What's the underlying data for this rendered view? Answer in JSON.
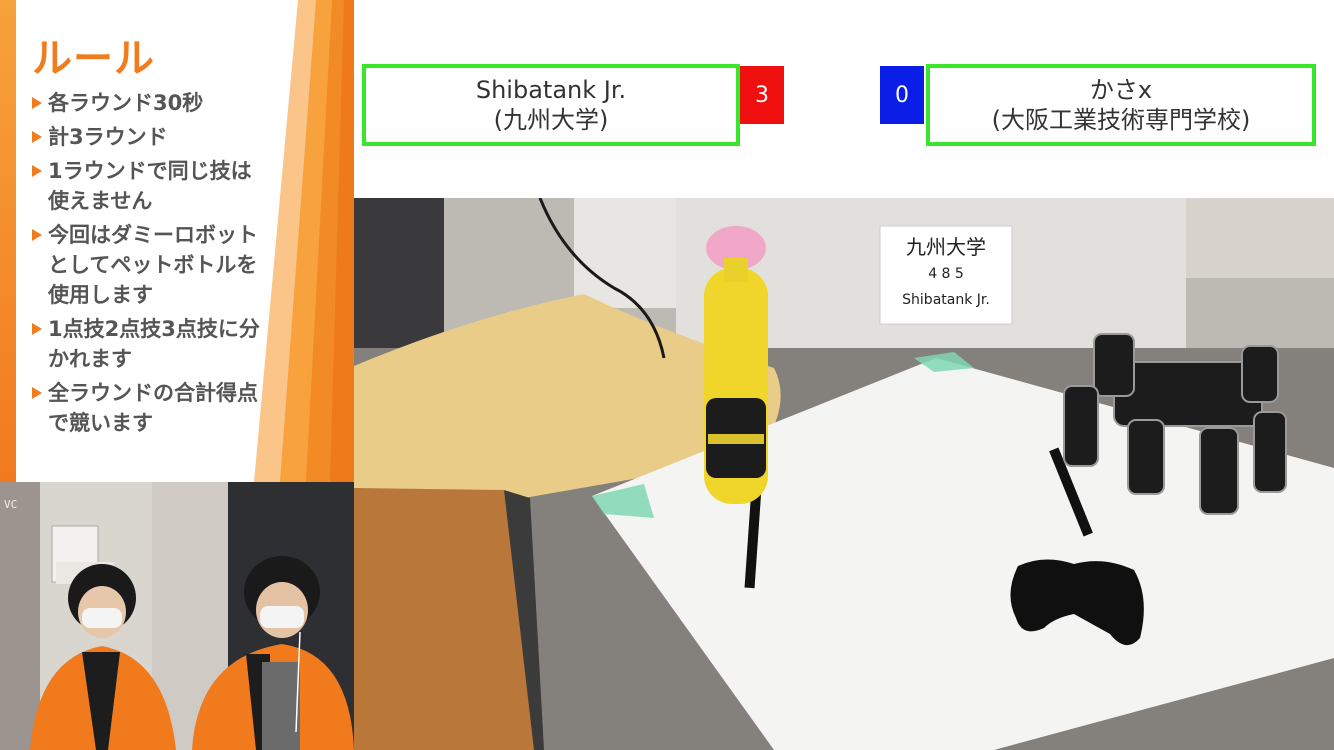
{
  "rules": {
    "title": "ルール",
    "items": [
      {
        "lines": [
          "各ラウンド30秒"
        ]
      },
      {
        "lines": [
          "計3ラウンド"
        ]
      },
      {
        "lines": [
          "1ラウンドで同じ技は",
          "使えません"
        ]
      },
      {
        "lines": [
          "今回はダミーロボット",
          "としてペットボトルを",
          "使用します"
        ]
      },
      {
        "lines": [
          "1点技2点技3点技に分",
          "かれます"
        ]
      },
      {
        "lines": [
          "全ラウンドの合計得点",
          "で競います"
        ]
      }
    ]
  },
  "scoreboard": {
    "team_a": {
      "name": "Shibatank Jr.",
      "affiliation": "(九州大学)",
      "score": "3"
    },
    "team_b": {
      "name": "かさx",
      "affiliation": "(大阪工業技術専門学校)",
      "score": "0"
    }
  },
  "arena": {
    "sign_lines": [
      "九州大学",
      "4 8 5",
      "Shibatank Jr."
    ]
  },
  "camera": {
    "watermark": "VC"
  },
  "colors": {
    "accent_orange": "#f07c1e",
    "team_border_green": "#3ae62a",
    "score_red": "#f00f0f",
    "score_blue": "#0a1ee8"
  }
}
